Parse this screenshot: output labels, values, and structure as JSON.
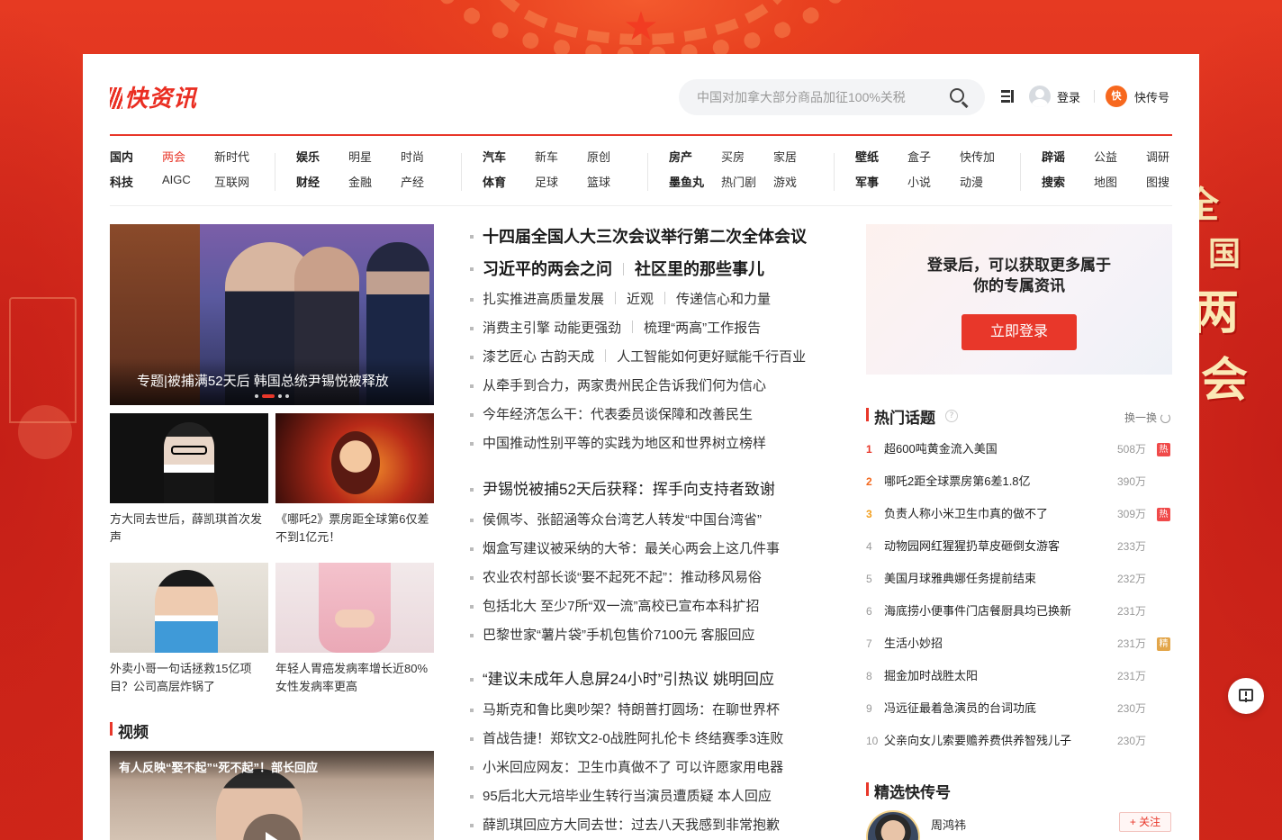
{
  "header": {
    "logo_text": "快资讯",
    "search_placeholder": "中国对加拿大部分商品加征100%关税",
    "login_label": "登录",
    "kcx_label": "快传号",
    "kcx_badge": "快"
  },
  "nav": {
    "groups": [
      {
        "row1": [
          "国内",
          "两会",
          "新时代"
        ],
        "row2": [
          "科技",
          "AIGC",
          "互联网"
        ]
      },
      {
        "row1": [
          "娱乐",
          "明星",
          "时尚"
        ],
        "row2": [
          "财经",
          "金融",
          "产经"
        ]
      },
      {
        "row1": [
          "汽车",
          "新车",
          "原创"
        ],
        "row2": [
          "体育",
          "足球",
          "篮球"
        ]
      },
      {
        "row1": [
          "房产",
          "买房",
          "家居"
        ],
        "row2": [
          "墨鱼丸",
          "热门剧",
          "游戏"
        ]
      },
      {
        "row1": [
          "壁纸",
          "盒子",
          "快传加"
        ],
        "row2": [
          "军事",
          "小说",
          "动漫"
        ]
      },
      {
        "row1": [
          "辟谣",
          "公益",
          "调研"
        ],
        "row2": [
          "搜索",
          "地图",
          "图搜"
        ]
      }
    ]
  },
  "hero": {
    "caption": "专题|被捕满52天后 韩国总统尹锡悦被释放"
  },
  "thumbs": [
    {
      "caption": "方大同去世后，薛凯琪首次发声"
    },
    {
      "caption": "《哪吒2》票房距全球第6仅差不到1亿元！"
    },
    {
      "caption": "外卖小哥一句话拯救15亿项目？公司高层炸锅了"
    },
    {
      "caption": "年轻人胃癌发病率增长近80% 女性发病率更高"
    }
  ],
  "video": {
    "section_title": "视频",
    "title": "有人反映“娶不起”“死不起”！部长回应"
  },
  "news_blocks": [
    {
      "lead": [
        "十四届全国人大三次会议举行第二次全体会议",
        "习近平的两会之问",
        "社区里的那些事儿"
      ],
      "items": [
        [
          "扎实推进高质量发展",
          "近观",
          "传递信心和力量"
        ],
        [
          "消费主引擎 动能更强劲",
          "梳理“两高”工作报告"
        ],
        [
          "漆艺匠心 古韵天成",
          "人工智能如何更好赋能千行百业"
        ],
        [
          "从牵手到合力，两家贵州民企告诉我们何为信心"
        ],
        [
          "今年经济怎么干：代表委员谈保障和改善民生"
        ],
        [
          "中国推动性别平等的实践为地区和世界树立榜样"
        ]
      ]
    },
    {
      "lead": "尹锡悦被捕52天后获释：挥手向支持者致谢",
      "items": [
        "侯佩岑、张韶涵等众台湾艺人转发“中国台湾省”",
        "烟盒写建议被采纳的大爷：最关心两会上这几件事",
        "农业农村部长谈“娶不起死不起”：推动移风易俗",
        "包括北大 至少7所“双一流”高校已宣布本科扩招",
        "巴黎世家“薯片袋”手机包售价7100元 客服回应"
      ]
    },
    {
      "lead": "“建议未成年人息屏24小时”引热议 姚明回应",
      "items": [
        "马斯克和鲁比奥吵架？特朗普打圆场：在聊世界杯",
        "首战告捷！郑钦文2-0战胜阿扎伦卡 终结赛季3连败",
        "小米回应网友：卫生巾真做不了 可以许愿家用电器",
        "95后北大元培毕业生转行当演员遭质疑 本人回应",
        "薛凯琪回应方大同去世：过去八天我感到非常抱歉"
      ]
    }
  ],
  "login_box": {
    "message_line1": "登录后，可以获取更多属于",
    "message_line2": "你的专属资讯",
    "button": "立即登录"
  },
  "hot_topics": {
    "title": "热门话题",
    "refresh_label": "换一换",
    "items": [
      {
        "rank": "1",
        "title": "超600吨黄金流入美国",
        "count": "508万",
        "tag": "热"
      },
      {
        "rank": "2",
        "title": "哪吒2距全球票房第6差1.8亿",
        "count": "390万",
        "tag": ""
      },
      {
        "rank": "3",
        "title": "负责人称小米卫生巾真的做不了",
        "count": "309万",
        "tag": "热"
      },
      {
        "rank": "4",
        "title": "动物园网红猩猩扔草皮砸倒女游客",
        "count": "233万",
        "tag": ""
      },
      {
        "rank": "5",
        "title": "美国月球雅典娜任务提前结束",
        "count": "232万",
        "tag": ""
      },
      {
        "rank": "6",
        "title": "海底捞小便事件门店餐厨具均已换新",
        "count": "231万",
        "tag": ""
      },
      {
        "rank": "7",
        "title": "生活小妙招",
        "count": "231万",
        "tag": "精"
      },
      {
        "rank": "8",
        "title": "掘金加时战胜太阳",
        "count": "231万",
        "tag": ""
      },
      {
        "rank": "9",
        "title": "冯远征最着急演员的台词功底",
        "count": "230万",
        "tag": ""
      },
      {
        "rank": "10",
        "title": "父亲向女儿索要赡养费供养智残儿子",
        "count": "230万",
        "tag": ""
      }
    ]
  },
  "kcx_section": {
    "title": "精选快传号",
    "user_name": "周鸿祎",
    "follow_label": "+ 关注"
  },
  "background": {
    "slogan": [
      "全",
      "国",
      "两",
      "会"
    ]
  },
  "colors": {
    "accent": "#e8372a",
    "background": "#d92b1f"
  }
}
